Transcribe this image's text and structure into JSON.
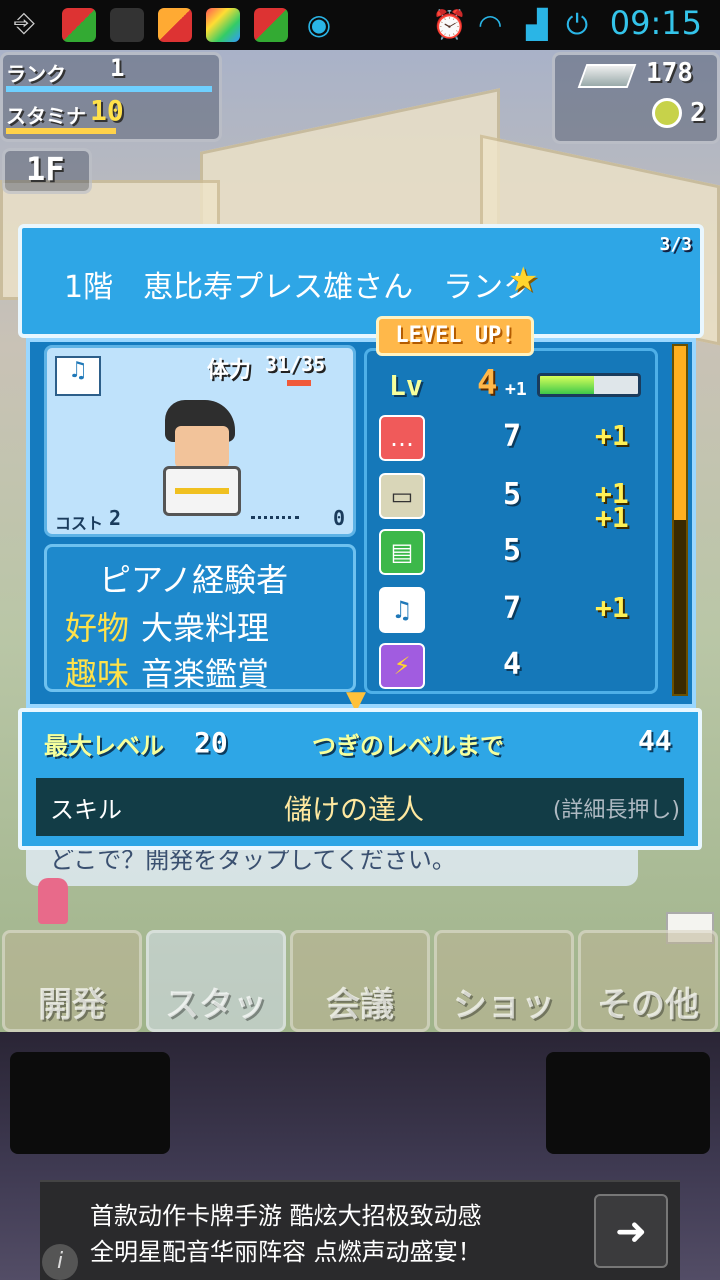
{
  "status_bar": {
    "time": "09:15"
  },
  "hud": {
    "rank_label": "ランク",
    "rank_value": "1",
    "stamina_label": "スタミナ",
    "stamina_value": "10",
    "floor": "1F",
    "bars": "178",
    "coins": "2"
  },
  "dialog": {
    "title": "1階　恵比寿プレス雄さん　ランク",
    "page": "3/3",
    "stamina_label": "体力",
    "stamina": "31/35",
    "cost_label": "コスト",
    "cost": "2",
    "gauge_value": "0",
    "job": "ピアノ経験者",
    "like_label": "好物",
    "like": "大衆料理",
    "hobby_label": "趣味",
    "hobby": "音楽鑑賞",
    "level_up": "LEVEL UP!",
    "lv_label": "Lv",
    "lv": "4",
    "lv_plus": "+1",
    "lv_progress": 0.55,
    "stats": [
      {
        "icon": "speech-icon",
        "value": "7",
        "plus": "+1"
      },
      {
        "icon": "computer-icon",
        "value": "5",
        "plus": "+1"
      },
      {
        "icon": "scroll-icon",
        "value": "5",
        "plus": "+1"
      },
      {
        "icon": "keyboard-music-icon",
        "value": "7",
        "plus": "+1"
      },
      {
        "icon": "lightning-icon",
        "value": "4",
        "plus": ""
      }
    ],
    "max_level_label": "最大レベル",
    "max_level": "20",
    "next_level_label": "つぎのレベルまで",
    "next_level": "44",
    "skill_label": "スキル",
    "skill_name": "儲けの達人",
    "skill_hint": "(詳細長押し)"
  },
  "message": "どこで？開発をタップしてください。",
  "tabs": [
    "開発",
    "スタッフ",
    "会議",
    "ショップ",
    "その他"
  ],
  "ad": {
    "line1": "首款动作卡牌手游 酷炫大招极致动感",
    "line2": "全明星配音华丽阵容 点燃声动盛宴！",
    "info": "i"
  }
}
